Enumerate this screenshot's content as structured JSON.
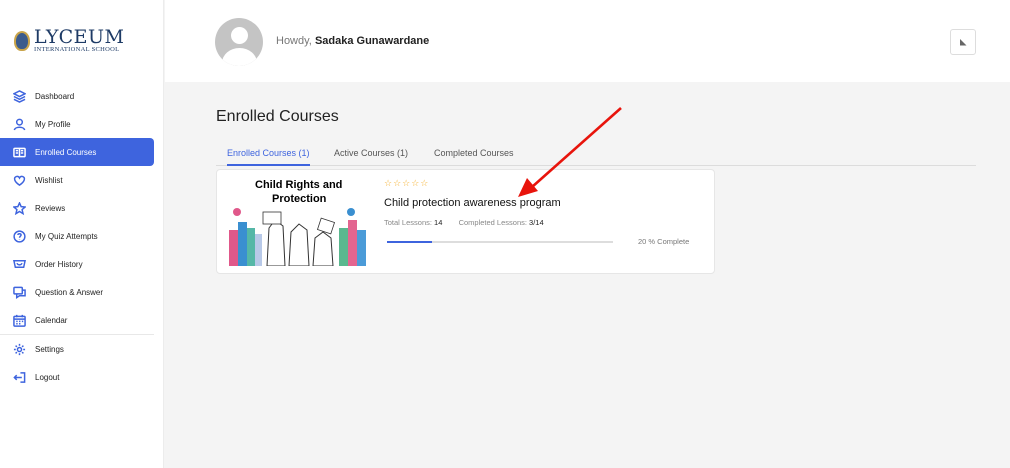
{
  "brand": {
    "name": "LYCEUM",
    "subtitle": "INTERNATIONAL SCHOOL"
  },
  "sidebar": {
    "items": [
      {
        "label": "Dashboard",
        "icon": "dashboard-icon"
      },
      {
        "label": "My Profile",
        "icon": "user-icon"
      },
      {
        "label": "Enrolled Courses",
        "icon": "book-icon",
        "active": true
      },
      {
        "label": "Wishlist",
        "icon": "heart-icon"
      },
      {
        "label": "Reviews",
        "icon": "star-icon"
      },
      {
        "label": "My Quiz Attempts",
        "icon": "quiz-icon"
      },
      {
        "label": "Order History",
        "icon": "cart-icon"
      },
      {
        "label": "Question & Answer",
        "icon": "qa-icon"
      },
      {
        "label": "Calendar",
        "icon": "calendar-icon"
      },
      {
        "label": "Settings",
        "icon": "gear-icon"
      },
      {
        "label": "Logout",
        "icon": "logout-icon"
      }
    ]
  },
  "header": {
    "greeting": "Howdy,",
    "user_name": "Sadaka Gunawardane"
  },
  "main": {
    "title": "Enrolled Courses",
    "tabs": [
      {
        "label": "Enrolled Courses (1)",
        "active": true
      },
      {
        "label": "Active Courses (1)",
        "active": false
      },
      {
        "label": "Completed Courses",
        "active": false
      }
    ],
    "course": {
      "thumb_line1": "Child Rights and",
      "thumb_line2": "Protection",
      "rating_stars": "☆☆☆☆☆",
      "rating_value": 0,
      "title": "Child protection awareness program",
      "total_lessons_label": "Total Lessons:",
      "total_lessons": "14",
      "completed_lessons_label": "Completed Lessons:",
      "completed_lessons": "3/14",
      "progress_percent": 20,
      "progress_text": "20 % Complete"
    }
  },
  "colors": {
    "accent": "#3e64de",
    "star": "#f5b02e",
    "annotation_arrow": "#e8140c"
  }
}
